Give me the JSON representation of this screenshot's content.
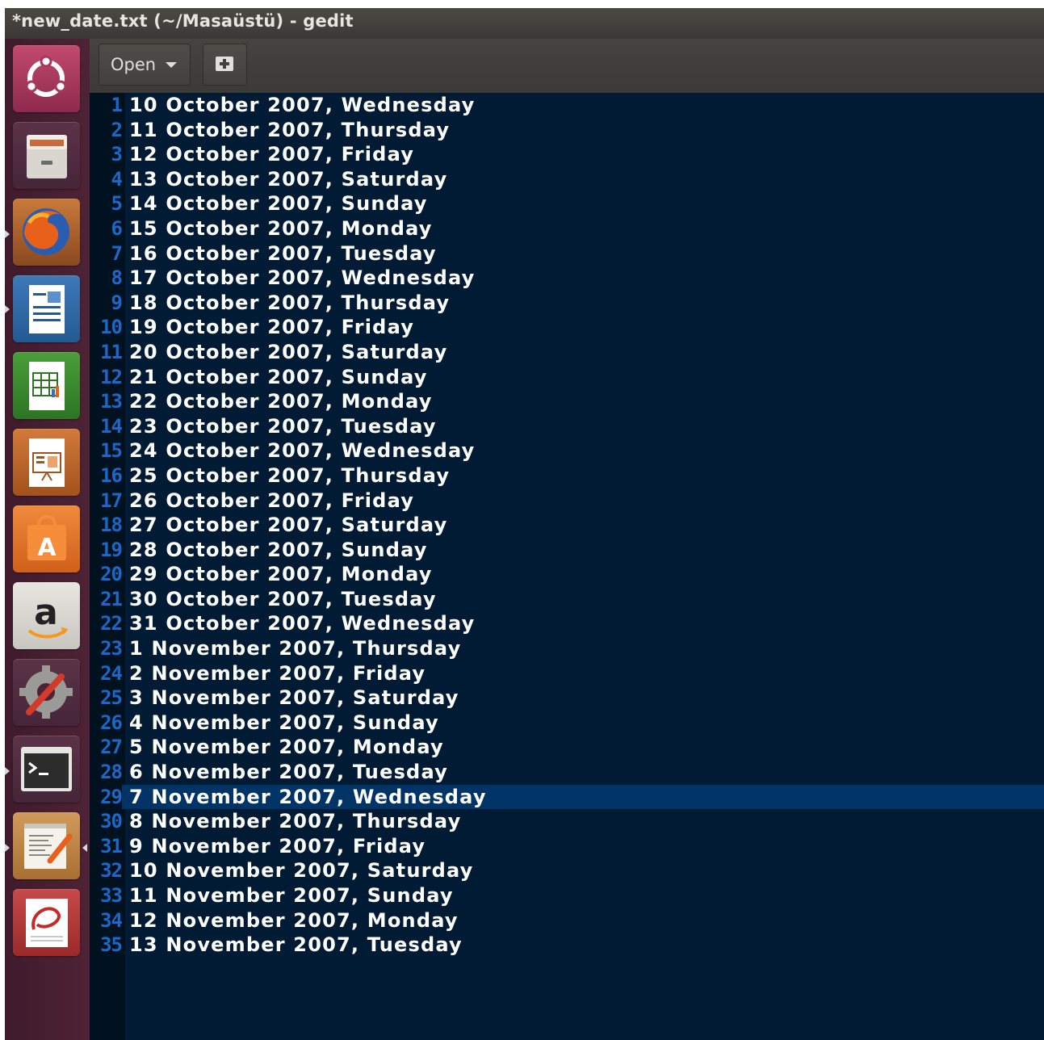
{
  "window": {
    "title": "*new_date.txt (~/Masaüstü) - gedit"
  },
  "toolbar": {
    "open_label": "Open"
  },
  "launcher": {
    "items": [
      {
        "name": "ubuntu-dash-icon"
      },
      {
        "name": "files-icon"
      },
      {
        "name": "firefox-icon"
      },
      {
        "name": "writer-icon"
      },
      {
        "name": "calc-icon"
      },
      {
        "name": "impress-icon"
      },
      {
        "name": "software-center-icon"
      },
      {
        "name": "amazon-icon"
      },
      {
        "name": "system-settings-icon"
      },
      {
        "name": "terminal-icon"
      },
      {
        "name": "gedit-icon"
      },
      {
        "name": "document-viewer-icon"
      }
    ]
  },
  "editor": {
    "current_line": 29,
    "lines": [
      {
        "n": "1",
        "text": "10 October 2007, Wednesday"
      },
      {
        "n": "2",
        "text": "11 October 2007, Thursday"
      },
      {
        "n": "3",
        "text": "12 October 2007, Friday"
      },
      {
        "n": "4",
        "text": "13 October 2007, Saturday"
      },
      {
        "n": "5",
        "text": "14 October 2007, Sunday"
      },
      {
        "n": "6",
        "text": "15 October 2007, Monday"
      },
      {
        "n": "7",
        "text": "16 October 2007, Tuesday"
      },
      {
        "n": "8",
        "text": "17 October 2007, Wednesday"
      },
      {
        "n": "9",
        "text": "18 October 2007, Thursday"
      },
      {
        "n": "10",
        "text": "19 October 2007, Friday"
      },
      {
        "n": "11",
        "text": "20 October 2007, Saturday"
      },
      {
        "n": "12",
        "text": "21 October 2007, Sunday"
      },
      {
        "n": "13",
        "text": "22 October 2007, Monday"
      },
      {
        "n": "14",
        "text": "23 October 2007, Tuesday"
      },
      {
        "n": "15",
        "text": "24 October 2007, Wednesday"
      },
      {
        "n": "16",
        "text": "25 October 2007, Thursday"
      },
      {
        "n": "17",
        "text": "26 October 2007, Friday"
      },
      {
        "n": "18",
        "text": "27 October 2007, Saturday"
      },
      {
        "n": "19",
        "text": "28 October 2007, Sunday"
      },
      {
        "n": "20",
        "text": "29 October 2007, Monday"
      },
      {
        "n": "21",
        "text": "30 October 2007, Tuesday"
      },
      {
        "n": "22",
        "text": "31 October 2007, Wednesday"
      },
      {
        "n": "23",
        "text": "1 November 2007, Thursday"
      },
      {
        "n": "24",
        "text": "2 November 2007, Friday"
      },
      {
        "n": "25",
        "text": "3 November 2007, Saturday"
      },
      {
        "n": "26",
        "text": "4 November 2007, Sunday"
      },
      {
        "n": "27",
        "text": "5 November 2007, Monday"
      },
      {
        "n": "28",
        "text": "6 November 2007, Tuesday"
      },
      {
        "n": "29",
        "text": "7 November 2007, Wednesday"
      },
      {
        "n": "30",
        "text": "8 November 2007, Thursday"
      },
      {
        "n": "31",
        "text": "9 November 2007, Friday"
      },
      {
        "n": "32",
        "text": "10 November 2007, Saturday"
      },
      {
        "n": "33",
        "text": "11 November 2007, Sunday"
      },
      {
        "n": "34",
        "text": "12 November 2007, Monday"
      },
      {
        "n": "35",
        "text": "13 November 2007, Tuesday"
      }
    ]
  }
}
